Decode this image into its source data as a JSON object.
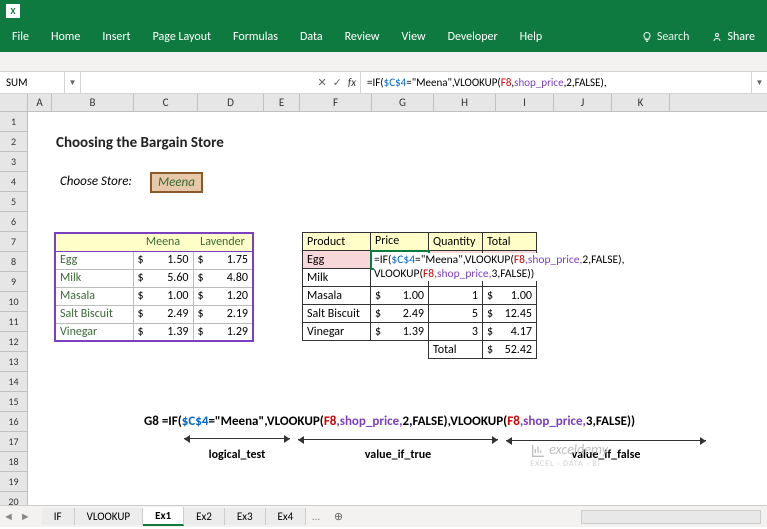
{
  "app": {
    "name": "Excel"
  },
  "ribbon": {
    "tabs": [
      "File",
      "Home",
      "Insert",
      "Page Layout",
      "Formulas",
      "Data",
      "Review",
      "View",
      "Developer",
      "Help"
    ],
    "search_placeholder": "Search",
    "share": "Share"
  },
  "namebox": "SUM",
  "formula_bar": "=IF($C$4=\"Meena\",VLOOKUP(F8,shop_price,2,FALSE),",
  "doc": {
    "title": "Choosing the Bargain Store",
    "choose_label": "Choose Store:",
    "choose_value": "Meena"
  },
  "tbl_left": {
    "headers": [
      "",
      "Meena",
      "Lavender"
    ],
    "rows": [
      {
        "p": "Egg",
        "m": "1.50",
        "l": "1.75"
      },
      {
        "p": "Milk",
        "m": "5.60",
        "l": "4.80"
      },
      {
        "p": "Masala",
        "m": "1.00",
        "l": "1.20"
      },
      {
        "p": "Salt Biscuit",
        "m": "2.49",
        "l": "2.19"
      },
      {
        "p": "Vinegar",
        "m": "1.39",
        "l": "1.29"
      }
    ]
  },
  "tbl_right": {
    "headers": [
      "Product",
      "Price",
      "Quantity",
      "Total"
    ],
    "rows": [
      {
        "p": "Egg",
        "price": "",
        "qty": "",
        "tot": ""
      },
      {
        "p": "Milk",
        "price": "",
        "qty": "",
        "tot": ""
      },
      {
        "p": "Masala",
        "price": "1.00",
        "qty": "1",
        "tot": "1.00"
      },
      {
        "p": "Salt Biscuit",
        "price": "2.49",
        "qty": "5",
        "tot": "12.45"
      },
      {
        "p": "Vinegar",
        "price": "1.39",
        "qty": "3",
        "tot": "4.17"
      }
    ],
    "total_label": "Total",
    "total_value": "52.42"
  },
  "tooltip": {
    "line1_pre": "=IF(",
    "line1_cond_a": "$C$4",
    "line1_cond_b": "=\"Meena\"",
    "line1_v1": ",VLOOKUP(",
    "line1_f8": "F8",
    "line1_sp": ",shop_price,",
    "line1_n": "2",
    "line1_end": ",FALSE),",
    "line2_v": "VLOOKUP(",
    "line2_f8": "F8",
    "line2_sp": ",shop_price,",
    "line2_n": "3",
    "line2_end": ",FALSE))"
  },
  "explain": {
    "ref": "G8",
    "eq": "=IF(",
    "cond_a": "$C$4",
    "cond_b": "=\"Meena\"",
    "v1": ",VLOOKUP(",
    "f8a": "F8",
    "sp": ",shop_price,",
    "n1": "2",
    "false1": ",FALSE),VLOOKUP(",
    "f8b": "F8",
    "sp2": ",shop_price,",
    "n2": "3",
    "end": ",FALSE))",
    "lbl1": "logical_test",
    "lbl2": "value_if_true",
    "lbl3": "value_if_false"
  },
  "sheets": [
    "IF",
    "VLOOKUP",
    "Ex1",
    "Ex2",
    "Ex3",
    "Ex4"
  ],
  "active_sheet": "Ex1",
  "columns": [
    "A",
    "B",
    "C",
    "D",
    "E",
    "F",
    "G",
    "H",
    "I",
    "J",
    "K"
  ],
  "watermark": "exceldemy",
  "watermark_sub": "EXCEL · DATA · BI"
}
